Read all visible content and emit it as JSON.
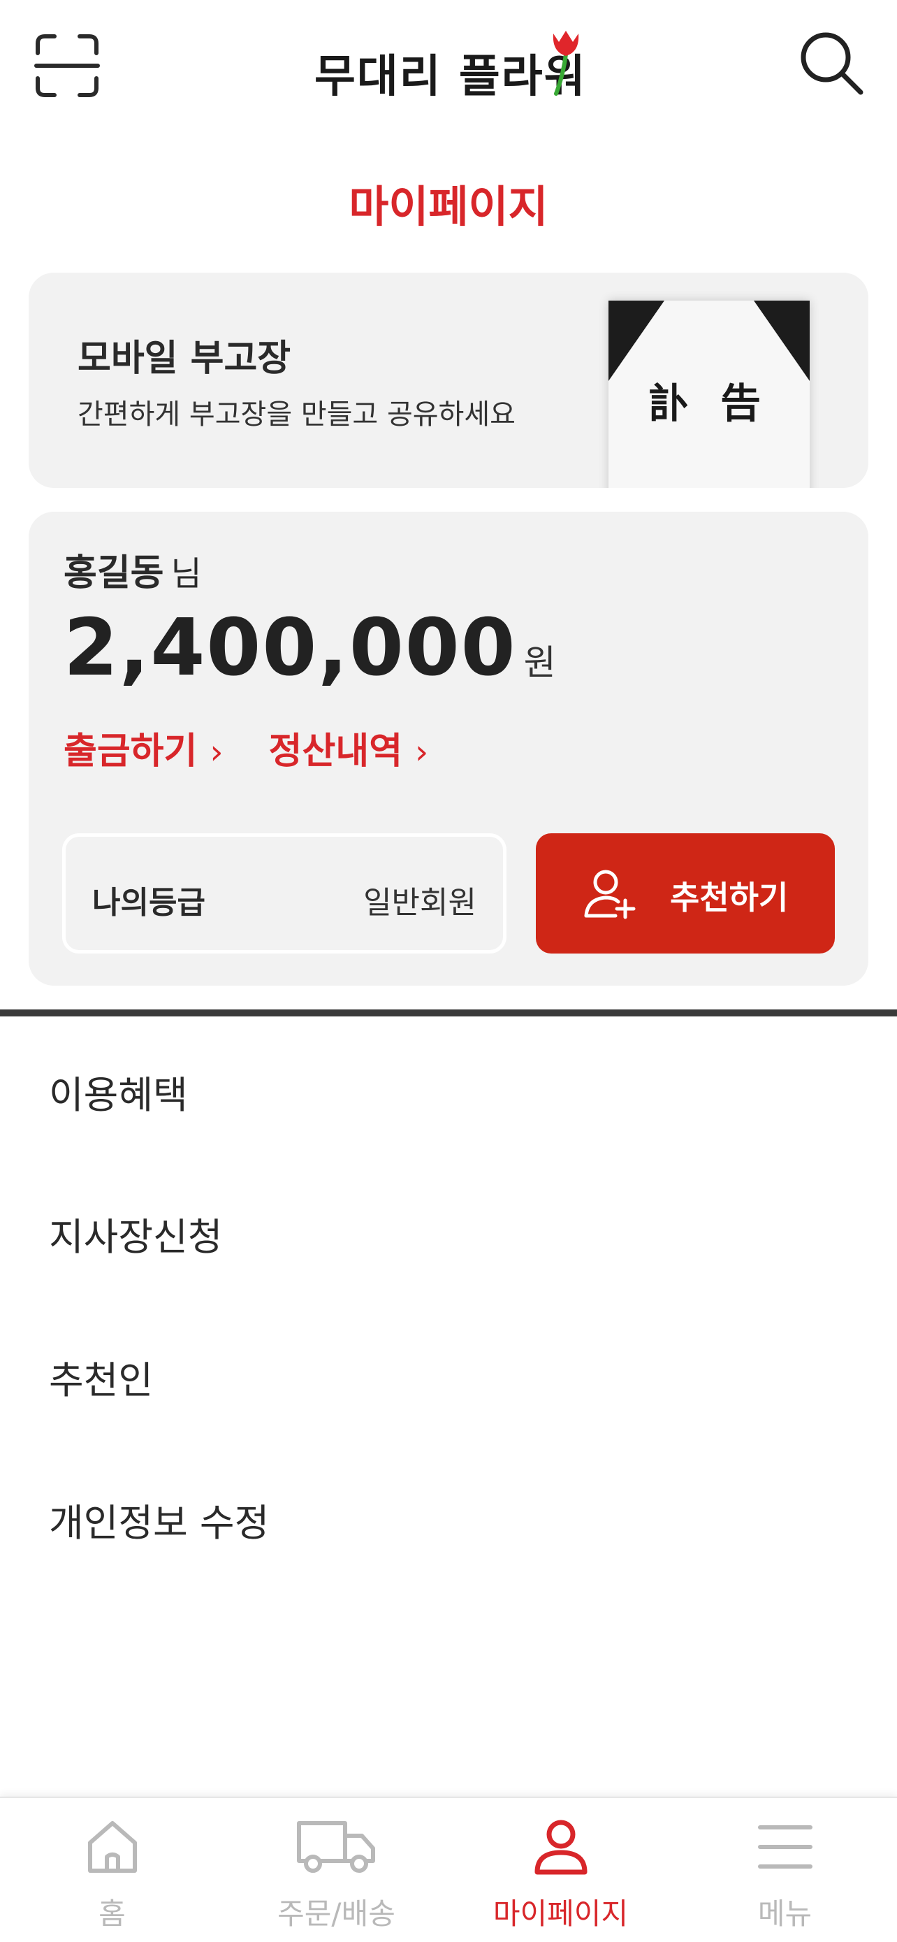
{
  "header": {
    "logo_text": "무대리 플라워",
    "scan_icon": "qr-scan-icon",
    "search_icon": "search-icon"
  },
  "page_title": "마이페이지",
  "obituary_card": {
    "title": "모바일 부고장",
    "description": "간편하게 부고장을 만들고 공유하세요",
    "image_text": "訃 告"
  },
  "account": {
    "name": "홍길동",
    "honorific": "님",
    "balance": "2,400,000",
    "currency": "원",
    "withdraw_label": "출금하기",
    "settlement_label": "정산내역",
    "grade_label": "나의등급",
    "grade_value": "일반회원",
    "recommend_label": "추천하기"
  },
  "menu": {
    "items": [
      "이용혜택",
      "지사장신청",
      "추천인",
      "개인정보 수정"
    ]
  },
  "bottom_nav": {
    "items": [
      {
        "label": "홈",
        "icon": "home-icon",
        "active": false
      },
      {
        "label": "주문/배송",
        "icon": "truck-icon",
        "active": false
      },
      {
        "label": "마이페이지",
        "icon": "user-icon",
        "active": true
      },
      {
        "label": "메뉴",
        "icon": "menu-icon",
        "active": false
      }
    ]
  },
  "colors": {
    "accent": "#d8262a",
    "button": "#cf2616",
    "card_bg": "#f2f2f2",
    "inactive_nav": "#b9b9b9"
  }
}
